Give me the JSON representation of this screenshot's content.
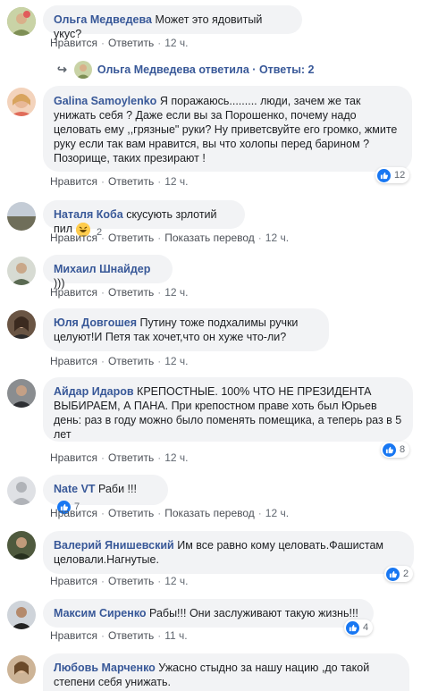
{
  "comments": [
    {
      "author": "Ольга Медведева",
      "text": "Может это ядовитый укус?",
      "like": "Нравится",
      "reply": "Ответить",
      "time": "12 ч."
    },
    {
      "author": "Galina Samoylenko",
      "text": "Я поражаюсь......... люди, зачем же так унижать себя ? Даже если вы за Порошенко, почему надо целовать ему ,,грязные\" руки? Ну приветсвуйте его громко, жмите руку если так вам нравится, вы что холопы перед барином ? Позорище, таких презирают !",
      "like": "Нравится",
      "reply": "Ответить",
      "time": "12 ч.",
      "reactions": "12"
    },
    {
      "author": "Наталя Коба",
      "text": "скусують зрлотий пил",
      "like": "Нравится",
      "reply": "Ответить",
      "translate": "Показать перевод",
      "time": "12 ч.",
      "reactions": "2"
    },
    {
      "author": "Михаил Шнайдер",
      "text": ")))",
      "like": "Нравится",
      "reply": "Ответить",
      "time": "12 ч."
    },
    {
      "author": "Юля Довгошея",
      "text": "Путину тоже подхалимы ручки целуют!И Петя так хочет,что он хуже что-ли?",
      "like": "Нравится",
      "reply": "Ответить",
      "time": "12 ч."
    },
    {
      "author": "Айдар Идаров",
      "text": "КРЕПОСТНЫЕ. 100% ЧТО НЕ ПРЕЗИДЕНТА ВЫБИРАЕМ, А ПАНА. При крепостном праве хоть был Юрьев день: раз в году можно было поменять помещика, а теперь раз в 5 лет",
      "like": "Нравится",
      "reply": "Ответить",
      "time": "12 ч.",
      "reactions": "8"
    },
    {
      "author": "Nate VT",
      "text": "Раби !!!",
      "like": "Нравится",
      "reply": "Ответить",
      "translate": "Показать перевод",
      "time": "12 ч.",
      "reactions": "7"
    },
    {
      "author": "Валерий Янишевский",
      "text": "Им все равно кому целовать.Фашистам целовали.Нагнутые.",
      "like": "Нравится",
      "reply": "Ответить",
      "time": "12 ч.",
      "reactions": "2"
    },
    {
      "author": "Максим Сиренко",
      "text": "Рабы!!! Они заслуживают такую жизнь!!!",
      "like": "Нравится",
      "reply": "Ответить",
      "time": "11 ч.",
      "reactions": "4"
    },
    {
      "author": "Любовь Марченко",
      "text": "Ужасно стыдно за нашу нацию ,до такой степени себя унижать."
    }
  ],
  "replies": {
    "author": "Ольга Медведева",
    "action": "ответила",
    "separator": "·",
    "count": "Ответы: 2"
  }
}
